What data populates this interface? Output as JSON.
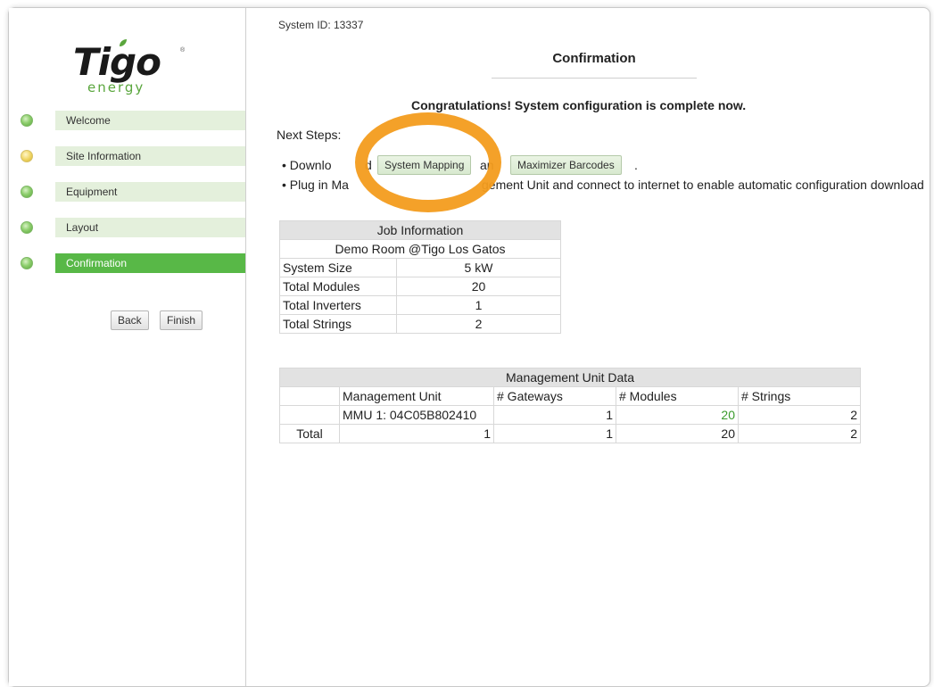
{
  "brand": {
    "name": "Tigo",
    "sub": "energy",
    "reg_mark": "®"
  },
  "colors": {
    "accent": "#58b847",
    "active_nav_text": "#ffffff",
    "highlight_ring": "#f39c1d",
    "modules_value": "#3a9b2c"
  },
  "nav": {
    "items": [
      {
        "label": "Welcome",
        "status": "green"
      },
      {
        "label": "Site Information",
        "status": "yellow"
      },
      {
        "label": "Equipment",
        "status": "green"
      },
      {
        "label": "Layout",
        "status": "green"
      },
      {
        "label": "Confirmation",
        "status": "green",
        "active": true
      }
    ],
    "back_label": "Back",
    "finish_label": "Finish"
  },
  "header": {
    "system_id": "System ID: 13337",
    "title": "Confirmation"
  },
  "main": {
    "congrats": "Congratulations! System configuration is complete now.",
    "next_steps_label": "Next Steps:",
    "step1": {
      "prefix": "• Downlo",
      "mid": "d",
      "btn1": "System Mapping",
      "and": "an",
      "btn2": "Maximizer Barcodes",
      "suffix": "."
    },
    "step2": {
      "prefix": "• Plug in Ma",
      "suffix": "gement Unit and connect to internet to enable automatic configuration download"
    }
  },
  "job_info": {
    "header": "Job Information",
    "job_name": "Demo Room @Tigo Los Gatos",
    "rows": [
      {
        "label": "System Size",
        "value": "5 kW"
      },
      {
        "label": "Total Modules",
        "value": "20"
      },
      {
        "label": "Total Inverters",
        "value": "1"
      },
      {
        "label": "Total Strings",
        "value": "2"
      }
    ]
  },
  "mgmt": {
    "header": "Management Unit Data",
    "columns": [
      "",
      "Management Unit",
      "# Gateways",
      "# Modules",
      "# Strings"
    ],
    "rows": [
      [
        "",
        "MMU 1: 04C05B802410",
        "1",
        "20",
        "2"
      ],
      [
        "Total",
        "1",
        "1",
        "20",
        "2"
      ]
    ]
  }
}
